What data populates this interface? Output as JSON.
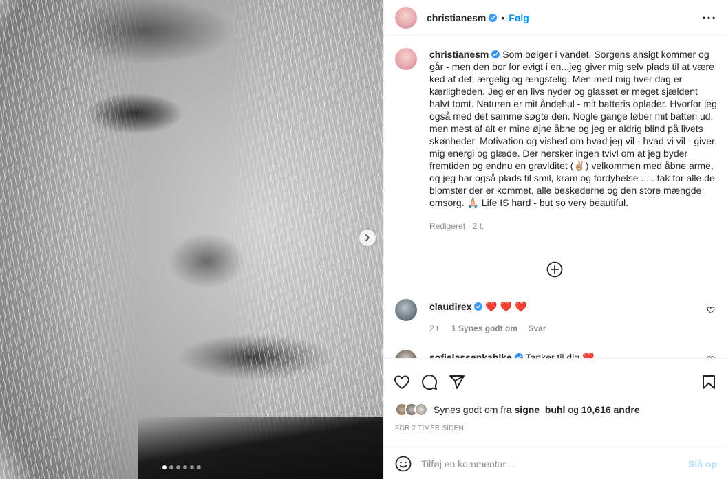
{
  "post": {
    "author": "christianesm",
    "follow_label": "Følg",
    "separator": "•",
    "caption": "Som bølger i vandet. Sorgens ansigt kommer og går - men den bor for evigt i en...jeg giver mig selv plads til at være ked af det, ærgelig og ængstelig. Men med mig hver dag er kærligheden. Jeg er en livs nyder og glasset er meget sjældent halvt tomt. Naturen er mit åndehul - mit batteris oplader. Hvorfor jeg også med det samme søgte den. Nogle gange løber mit batteri ud, men mest af alt er mine øjne åbne og jeg er aldrig blind på livets skønheder. Motivation og vished om hvad jeg vil - hvad vi vil - giver mig energi og glæde. Der hersker ingen tvivl om at jeg byder fremtiden og endnu en graviditet (✌🏼) velkommen med åbne arme, og jeg har også plads til smil, kram og fordybelse ..... tak for alle de blomster der er kommet, alle beskederne og den store mængde omsorg. 🙏🏼 Life IS hard - but so very beautiful.",
    "caption_meta": "Redigeret · 2 t."
  },
  "comments": [
    {
      "username": "claudirex",
      "text": "❤️ ❤️ ❤️",
      "time": "2 t.",
      "likes": "1 Synes godt om",
      "reply": "Svar"
    },
    {
      "username": "sofielassenkahlke",
      "text": "Tanker til dig ❤️"
    }
  ],
  "likes": {
    "prefix": "Synes godt om fra",
    "user": "signe_buhl",
    "and": "og",
    "others": "10,616 andre"
  },
  "timestamp": "FOR 2 TIMER SIDEN",
  "add_comment": {
    "placeholder": "Tilføj en kommentar ...",
    "post_label": "Slå op"
  },
  "colors": {
    "accent": "#0095f6",
    "verified": "#3897f0",
    "heart": "#ed4956",
    "muted": "#8e8e8e"
  },
  "carousel": {
    "slides": 6,
    "active": 1
  }
}
